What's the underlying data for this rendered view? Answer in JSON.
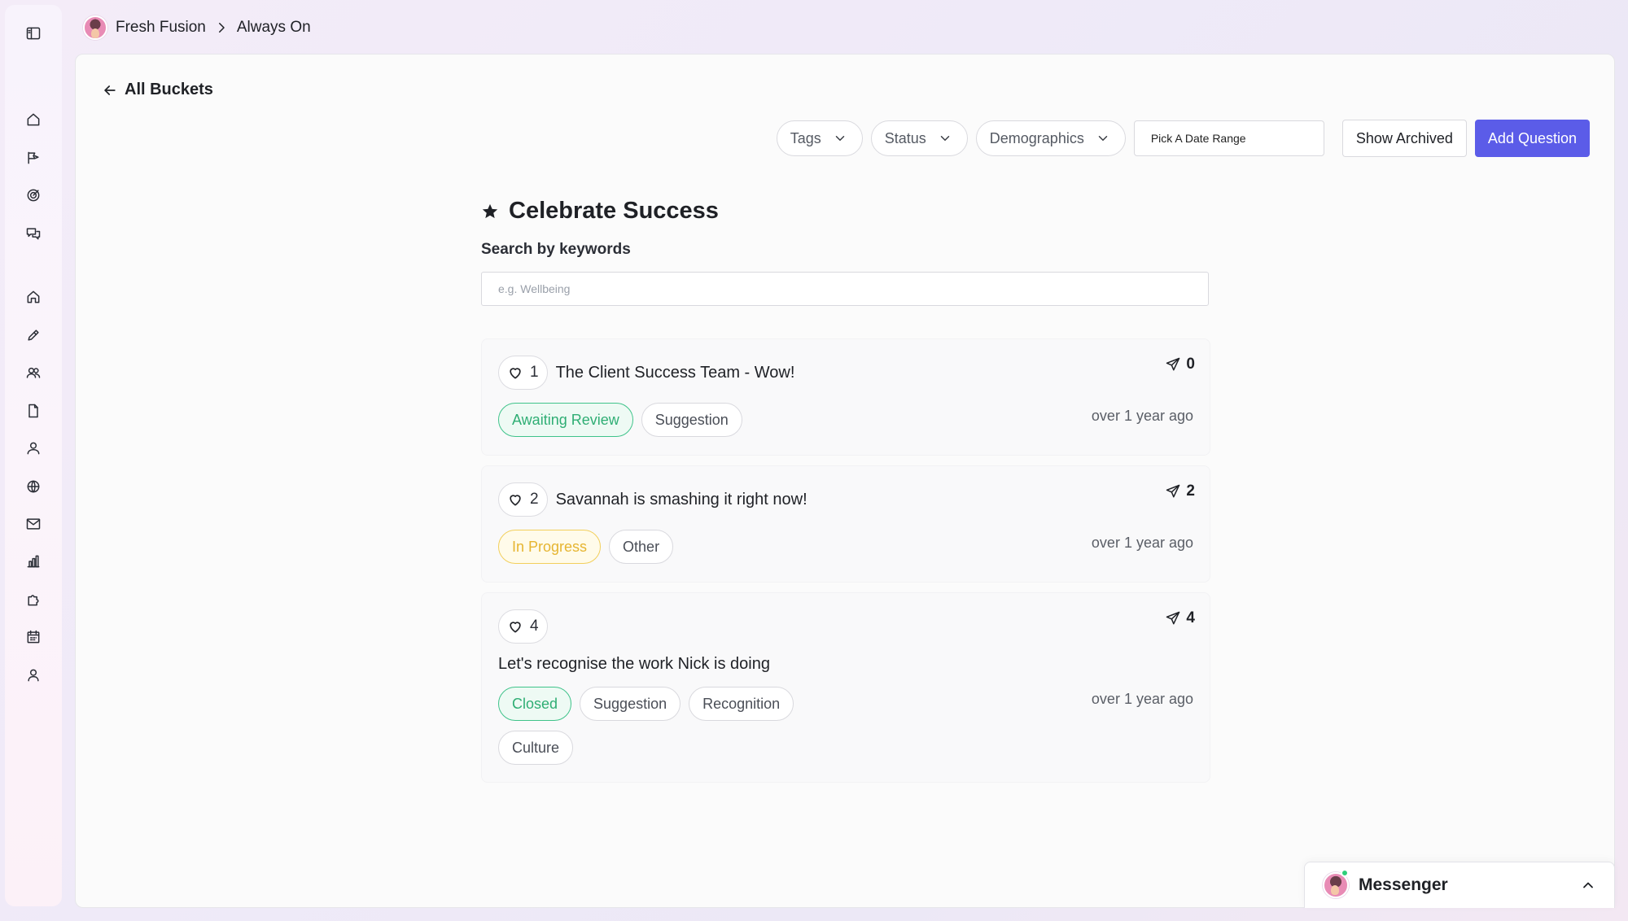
{
  "breadcrumb": {
    "org": "Fresh Fusion",
    "page": "Always On"
  },
  "back_link": "All Buckets",
  "filters": {
    "tags": "Tags",
    "status": "Status",
    "demographics": "Demographics",
    "date_placeholder": "Pick A Date Range",
    "show_archived": "Show Archived",
    "add_question": "Add Question"
  },
  "bucket": {
    "title": "Celebrate Success",
    "search_label": "Search by keywords",
    "search_placeholder": "e.g. Wellbeing"
  },
  "questions": [
    {
      "likes": "1",
      "title": "The Client Success Team - Wow!",
      "shares": "0",
      "status": "Awaiting Review",
      "tags": [
        "Suggestion"
      ],
      "time": "over 1 year ago"
    },
    {
      "likes": "2",
      "title": "Savannah is smashing it right now!",
      "shares": "2",
      "status": "In Progress",
      "tags": [
        "Other"
      ],
      "time": "over 1 year ago"
    },
    {
      "likes": "4",
      "title": "Let's recognise the work Nick is doing",
      "shares": "4",
      "status": "Closed",
      "tags": [
        "Suggestion",
        "Recognition",
        "Culture"
      ],
      "time": "over 1 year ago"
    }
  ],
  "messenger": {
    "label": "Messenger"
  },
  "colors": {
    "primary": "#5b5ce8",
    "status_green": "#2fae74",
    "status_yellow": "#e6b531",
    "online": "#2fcf7a"
  },
  "sidebar_icons": [
    "sidebar-toggle-icon",
    "home-icon",
    "campaign-icon",
    "target-icon",
    "chat-icon",
    "home-icon",
    "pencil-icon",
    "users-icon",
    "document-icon",
    "person-icon",
    "globe-icon",
    "mail-icon",
    "chart-icon",
    "puzzle-icon",
    "calendar-icon",
    "profile-icon"
  ]
}
